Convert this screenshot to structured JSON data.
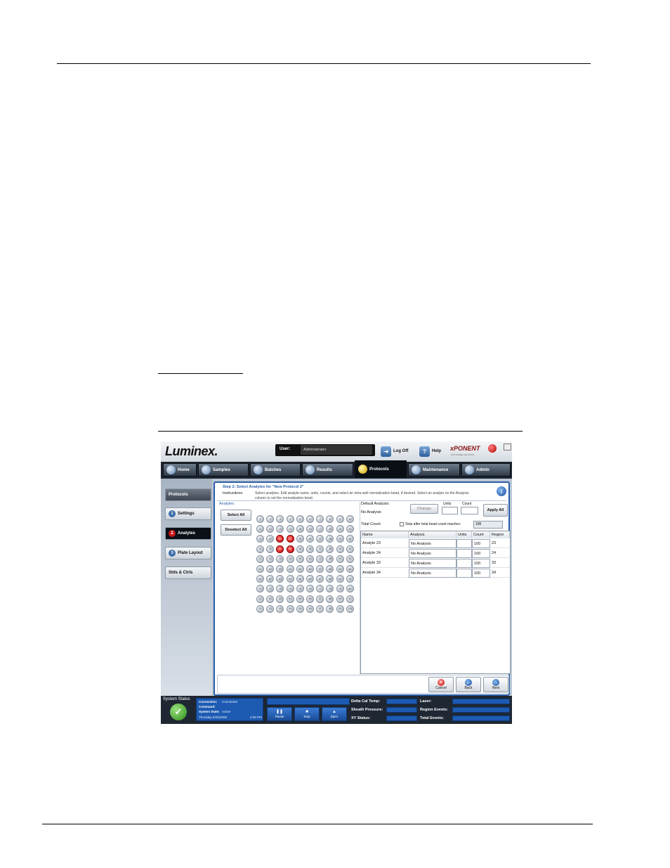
{
  "app": {
    "logo": "Luminex.",
    "user_label": "User:",
    "user_value": "Administrator",
    "logoff_label": "Log Off",
    "help_label": "Help",
    "brand": "xPONENT",
    "brand_sub": "SOFTWARE SOLUTION",
    "tabs": [
      {
        "label": "Home"
      },
      {
        "label": "Samples"
      },
      {
        "label": "Batches"
      },
      {
        "label": "Results"
      },
      {
        "label": "Protocols"
      },
      {
        "label": "Maintenance"
      },
      {
        "label": "Admin"
      }
    ],
    "sidebar": {
      "header": "Protocols",
      "items": [
        {
          "num": "1",
          "label": "Settings"
        },
        {
          "num": "2",
          "label": "Analytes"
        },
        {
          "num": "3",
          "label": "Plate Layout"
        },
        {
          "num": "",
          "label": "Stds & Ctrls"
        }
      ]
    },
    "main": {
      "step_title": "Step 2: Select Analytes for \"New Protocol 2\"",
      "instructions_label": "Instructions",
      "instructions_text": "Select analytes. Edit analyte name, units, counts, and select an intra-well normalization bead, if desired. Select an analyte on the Analysis column to set the normalization bead.",
      "analytes_label": "Analytes",
      "select_all": "Select All",
      "deselect_all": "Deselect All",
      "beads": [
        "1",
        "2",
        "3",
        "4",
        "5",
        "6",
        "7",
        "8",
        "9",
        "10",
        "11",
        "12",
        "13",
        "14",
        "15",
        "16",
        "17",
        "18",
        "19",
        "20",
        "21",
        "22",
        "23",
        "24",
        "25",
        "26",
        "27",
        "28",
        "29",
        "30",
        "31",
        "32",
        "33",
        "34",
        "35",
        "36",
        "37",
        "38",
        "39",
        "40",
        "41",
        "42",
        "43",
        "44",
        "45",
        "46",
        "47",
        "48",
        "49",
        "50",
        "51",
        "52",
        "53",
        "54",
        "55",
        "56",
        "57",
        "58",
        "59",
        "60",
        "61",
        "62",
        "63",
        "64",
        "65",
        "66",
        "67",
        "68",
        "69",
        "70",
        "71",
        "72",
        "73",
        "74",
        "75",
        "76",
        "77",
        "78",
        "79",
        "80",
        "81",
        "82",
        "83",
        "84",
        "85",
        "86",
        "87",
        "88",
        "89",
        "90",
        "91",
        "92",
        "93",
        "94",
        "95",
        "96",
        "97",
        "98",
        "99",
        "100"
      ],
      "selected_beads": [
        "23",
        "24",
        "33",
        "34"
      ],
      "default_analysis_label": "Default Analysis:",
      "default_analysis_value": "No Analysis",
      "change_button": "Change",
      "units_label": "Units",
      "count_label": "Count",
      "apply_all": "Apply All",
      "total_count_label": "Total Count",
      "stop_after_label": "Stop after total bead count reaches:",
      "stop_after_value": "100",
      "table": {
        "headers": [
          "Name",
          "Analysis",
          "Units",
          "Count",
          "Region"
        ],
        "rows": [
          [
            "Analyte 23",
            "No Analysis",
            "",
            "100",
            "23"
          ],
          [
            "Analyte 24",
            "No Analysis",
            "",
            "100",
            "24"
          ],
          [
            "Analyte 33",
            "No Analysis",
            "",
            "100",
            "33"
          ],
          [
            "Analyte 34",
            "No Analysis",
            "",
            "100",
            "34"
          ]
        ]
      },
      "footer": {
        "cancel": "Cancel",
        "back": "Back",
        "next": "Next"
      }
    },
    "status": {
      "title": "System Status",
      "connection_label": "Connection:",
      "connection_value": "Connected",
      "command_label": "Command:",
      "command_value": "",
      "system_state_label": "System State:",
      "system_state_value": "Active",
      "date": "Thursday 6/26/2008",
      "time": "4:05 PM",
      "controls": [
        "Pause",
        "Stop",
        "Eject"
      ],
      "delta_cal_temp": "Delta Cal Temp:",
      "sheath_pressure": "Sheath Pressure:",
      "xy_status": "XY Status:",
      "laser": "Laser:",
      "region_events": "Region Events:",
      "total_events": "Total Events:"
    }
  }
}
